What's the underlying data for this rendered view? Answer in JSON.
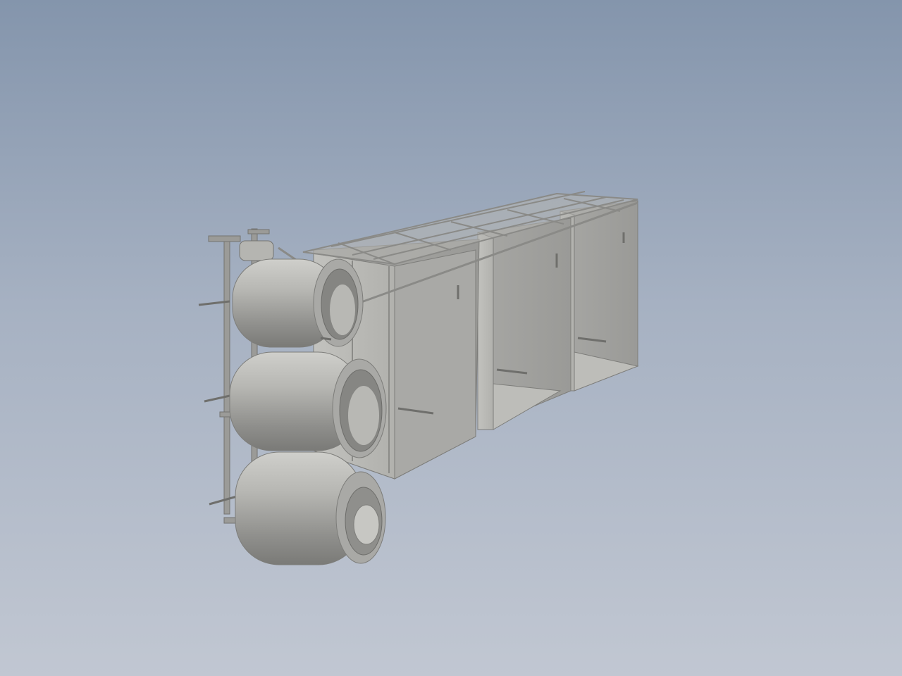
{
  "viewport": {
    "background_top": "#8495ac",
    "background_bottom": "#c1c7d2",
    "model_color": "#a2a29f",
    "model_dark": "#7d7d7a",
    "model_light": "#d0d0cc"
  },
  "model": {
    "tanks": 3,
    "frame_bays": 3
  }
}
